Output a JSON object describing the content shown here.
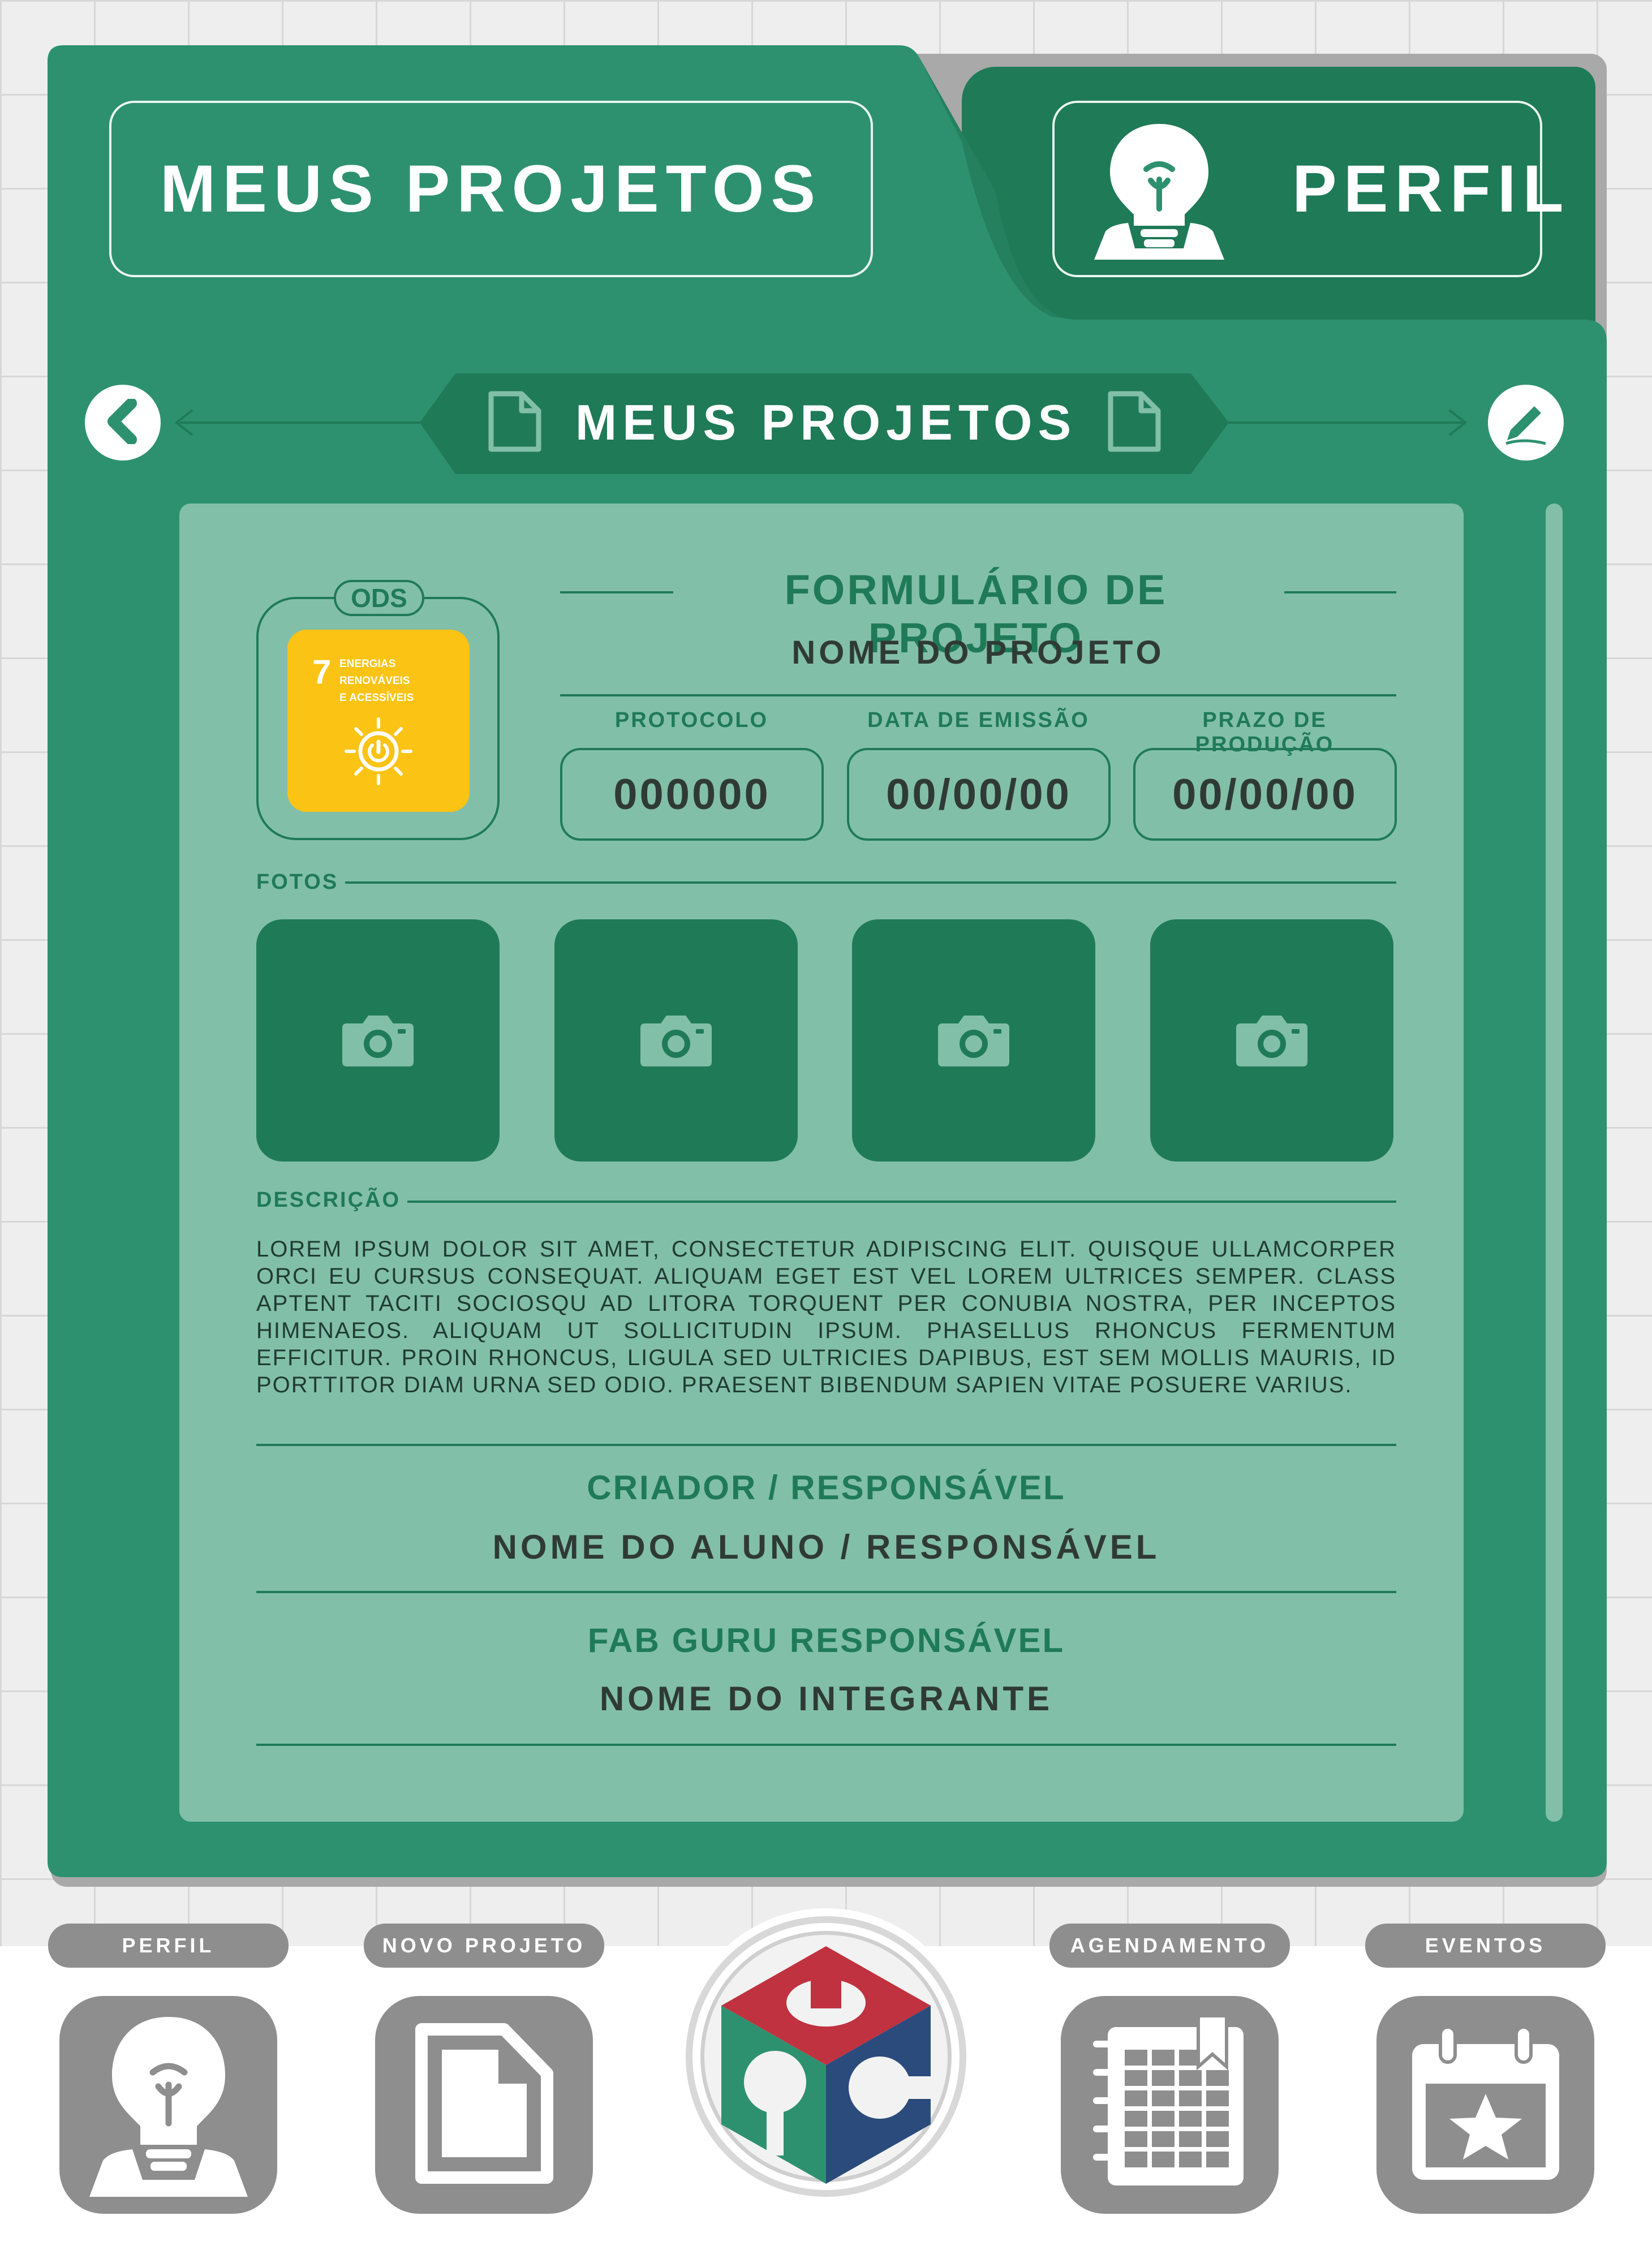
{
  "header": {
    "tab_meus_projetos": "MEUS PROJETOS",
    "tab_perfil": "PERFIL"
  },
  "banner": {
    "title": "MEUS PROJETOS",
    "back_icon": "chevron-left-icon",
    "edit_icon": "pencil-icon",
    "doc_icon": "document-icon"
  },
  "ods": {
    "label": "ODS",
    "number": "7",
    "text_lines": [
      "ENERGIAS",
      "RENOVÁVEIS",
      "E ACESSÍVEIS"
    ],
    "icon": "sun-power-icon"
  },
  "form": {
    "title": "FORMULÁRIO DE PROJETO",
    "project_name": "NOME DO PROJETO",
    "fields": [
      {
        "label": "PROTOCOLO",
        "value": "000000"
      },
      {
        "label": "DATA DE EMISSÃO",
        "value": "00/00/00"
      },
      {
        "label": "PRAZO DE PRODUÇÃO",
        "value": "00/00/00"
      }
    ],
    "photos_label": "FOTOS",
    "photos": [
      "camera-icon",
      "camera-icon",
      "camera-icon",
      "camera-icon"
    ],
    "description_label": "DESCRIÇÃO",
    "description": "LOREM IPSUM DOLOR SIT AMET, CONSECTETUR ADIPISCING ELIT. QUISQUE ULLAMCORPER ORCI EU CURSUS CONSEQUAT. ALIQUAM EGET EST VEL LOREM ULTRICES SEMPER. CLASS APTENT TACITI SOCIOSQU AD LITORA TORQUENT PER CONUBIA NOSTRA, PER INCEPTOS HIMENAEOS. ALIQUAM UT SOLLICITUDIN IPSUM. PHASELLUS RHONCUS FERMENTUM EFFICITUR. PROIN RHONCUS, LIGULA SED ULTRICIES DAPIBUS, EST SEM MOLLIS MAURIS, ID PORTTITOR DIAM URNA SED ODIO. PRAESENT BIBENDUM SAPIEN VITAE POSUERE VARIUS.",
    "creator_label": "CRIADOR / RESPONSÁVEL",
    "creator_value": "NOME DO ALUNO / RESPONSÁVEL",
    "guru_label": "FAB GURU RESPONSÁVEL",
    "guru_value": "NOME DO INTEGRANTE"
  },
  "bottom_nav": [
    {
      "label": "PERFIL",
      "icon": "lightbulb-person-icon"
    },
    {
      "label": "NOVO PROJETO",
      "icon": "document-icon"
    },
    {
      "label": "",
      "icon": "fablab-logo"
    },
    {
      "label": "AGENDAMENTO",
      "icon": "planner-icon"
    },
    {
      "label": "EVENTOS",
      "icon": "calendar-star-icon"
    }
  ],
  "colors": {
    "primary": "#2d9170",
    "dark": "#1f7a58",
    "light": "#82bfa9",
    "ods_yellow": "#fbc313",
    "nav_gray": "#8e8e8e"
  }
}
